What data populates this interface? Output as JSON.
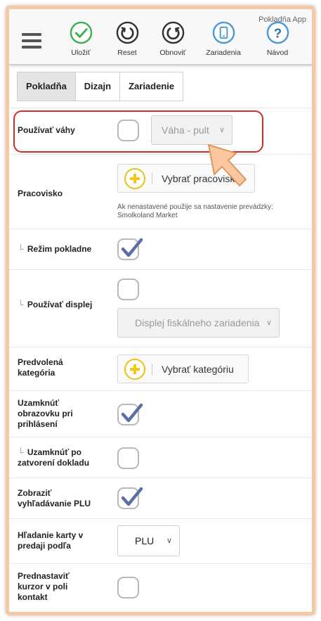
{
  "app_title": "Pokladňa App",
  "toolbar": {
    "save_label": "Uložiť",
    "reset_label": "Reset",
    "refresh_label": "Obnoviť",
    "devices_label": "Zariadenia",
    "help_label": "Návod"
  },
  "tabs": [
    "Pokladňa",
    "Dizajn",
    "Zariadenie"
  ],
  "settings": {
    "use_scale": {
      "label": "Používať váhy",
      "checked": false,
      "select_value": "Váha - pult"
    },
    "workplace": {
      "label": "Pracovisko",
      "button": "Vybrať pracovisko",
      "hint_line1": "Ak nenastavené použije sa nastavenie prevádzky:",
      "hint_line2": "Smolkoland Market"
    },
    "cashier_mode": {
      "prefix": "└",
      "label": "Režim pokladne",
      "checked": true
    },
    "use_display": {
      "prefix": "└",
      "label": "Používať displej",
      "checked": false,
      "select_value": "Displej fiskálneho zariadenia"
    },
    "default_category": {
      "label_line1": "Predvolená",
      "label_line2": "kategória",
      "button": "Vybrať kategóriu"
    },
    "lock_on_login": {
      "label_line1": "Uzamknúť",
      "label_line2": "obrazovku pri",
      "label_line3": "prihlásení",
      "checked": true
    },
    "lock_after_receipt": {
      "prefix": "└",
      "label_line1": "Uzamknúť po",
      "label_line2": "zatvorení dokladu",
      "checked": false
    },
    "show_plu_search": {
      "label_line1": "Zobraziť",
      "label_line2": "vyhľadávanie PLU",
      "checked": true
    },
    "card_search": {
      "label_line1": "Hľadanie karty v",
      "label_line2": "predaji podľa",
      "select_value": "PLU"
    },
    "cursor_contact": {
      "label_line1": "Prednastaviť",
      "label_line2": "kurzor v poli",
      "label_line3": "kontakt",
      "checked": false
    }
  },
  "colors": {
    "accent_green": "#3cae50",
    "accent_blue": "#4a9ad6",
    "checkmark": "#5b6fa3",
    "highlight_red": "#d42a2a",
    "plus_yellow": "#f0c814"
  }
}
